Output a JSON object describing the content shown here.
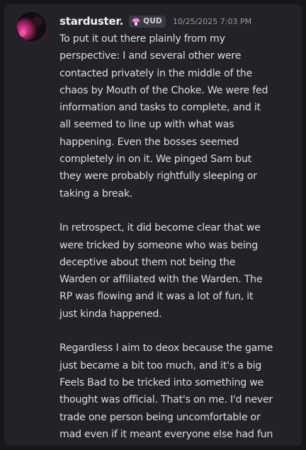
{
  "message": {
    "author": "starduster.",
    "tag": {
      "label": "QUD",
      "icon": "mushroom-icon"
    },
    "timestamp": "10/25/2025 7:03 PM",
    "paragraphs": [
      [
        "To put it out there plainly from my",
        "perspective: I and several other were",
        "contacted privately in the middle of the",
        "chaos by Mouth of the Choke. We were fed",
        "information and tasks to complete, and it",
        "all seemed to line up with what was",
        "happening. Even the bosses seemed",
        "completely in on it. We pinged Sam but",
        "they were probably rightfully sleeping or",
        "taking a break."
      ],
      [
        "In retrospect, it did become clear that we",
        "were tricked by someone who was being",
        "deceptive about them not being the",
        "Warden or affiliated with the Warden. The",
        "RP was flowing and it was a lot of fun, it",
        "just kinda happened."
      ],
      [
        "Regardless I aim to deox because the game",
        "just became a bit too much, and it's a big",
        "Feels Bad to be tricked into something we",
        "thought was official. That's on me. I'd never",
        "trade one person being uncomfortable or",
        "mad even if it meant everyone else had fun"
      ]
    ]
  },
  "colors": {
    "background": "#222228",
    "username": "#f2f3f5",
    "text": "#dbdee1",
    "timestamp": "#9a9ca5",
    "tag_bg": "#3a3a44",
    "avatar_accent": "#e0409a"
  }
}
